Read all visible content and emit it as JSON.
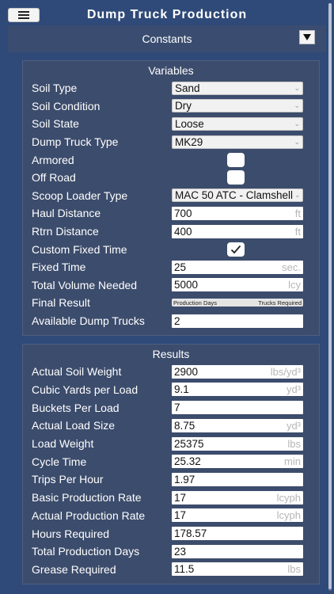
{
  "header": {
    "title": "Dump Truck Production",
    "menu_icon": "hamburger-icon"
  },
  "constants": {
    "title": "Constants",
    "expand_icon": "triangle-down-icon"
  },
  "variables": {
    "title": "Variables",
    "soil_type": {
      "label": "Soil Type",
      "value": "Sand"
    },
    "soil_condition": {
      "label": "Soil Condition",
      "value": "Dry"
    },
    "soil_state": {
      "label": "Soil State",
      "value": "Loose"
    },
    "dump_truck_type": {
      "label": "Dump Truck Type",
      "value": "MK29"
    },
    "armored": {
      "label": "Armored",
      "checked": false
    },
    "off_road": {
      "label": "Off Road",
      "checked": false
    },
    "scoop_loader_type": {
      "label": "Scoop Loader Type",
      "value": "MAC 50 ATC - Clamshell"
    },
    "haul_distance": {
      "label": "Haul Distance",
      "value": "700",
      "unit": "ft"
    },
    "rtrn_distance": {
      "label": "Rtrn Distance",
      "value": "400",
      "unit": "ft"
    },
    "custom_fixed_time": {
      "label": "Custom Fixed Time",
      "checked": true
    },
    "fixed_time": {
      "label": "Fixed Time",
      "value": "25",
      "unit": "sec."
    },
    "total_volume_needed": {
      "label": "Total Volume Needed",
      "value": "5000",
      "unit": "lcy"
    },
    "final_result": {
      "label": "Final Result",
      "option_left": "Production Days",
      "option_right": "Trucks Required"
    },
    "available_dump_trucks": {
      "label": "Available Dump Trucks",
      "value": "2"
    }
  },
  "results": {
    "title": "Results",
    "actual_soil_weight": {
      "label": "Actual Soil Weight",
      "value": "2900",
      "unit": "lbs/yd³"
    },
    "cubic_yards_per_load": {
      "label": "Cubic Yards per Load",
      "value": "9.1",
      "unit": "yd³"
    },
    "buckets_per_load": {
      "label": "Buckets Per Load",
      "value": "7"
    },
    "actual_load_size": {
      "label": "Actual Load Size",
      "value": "8.75",
      "unit": "yd³"
    },
    "load_weight": {
      "label": "Load Weight",
      "value": "25375",
      "unit": "lbs"
    },
    "cycle_time": {
      "label": "Cycle Time",
      "value": "25.32",
      "unit": "min"
    },
    "trips_per_hour": {
      "label": "Trips Per Hour",
      "value": "1.97"
    },
    "basic_production_rate": {
      "label": "Basic Production Rate",
      "value": "17",
      "unit": "lcyph"
    },
    "actual_production_rate": {
      "label": "Actual Production Rate",
      "value": "17",
      "unit": "lcyph"
    },
    "hours_required": {
      "label": "Hours Required",
      "value": "178.57"
    },
    "total_production_days": {
      "label": "Total Production Days",
      "value": "23"
    },
    "grease_required": {
      "label": "Grease Required",
      "value": "11.5",
      "unit": "lbs"
    }
  }
}
